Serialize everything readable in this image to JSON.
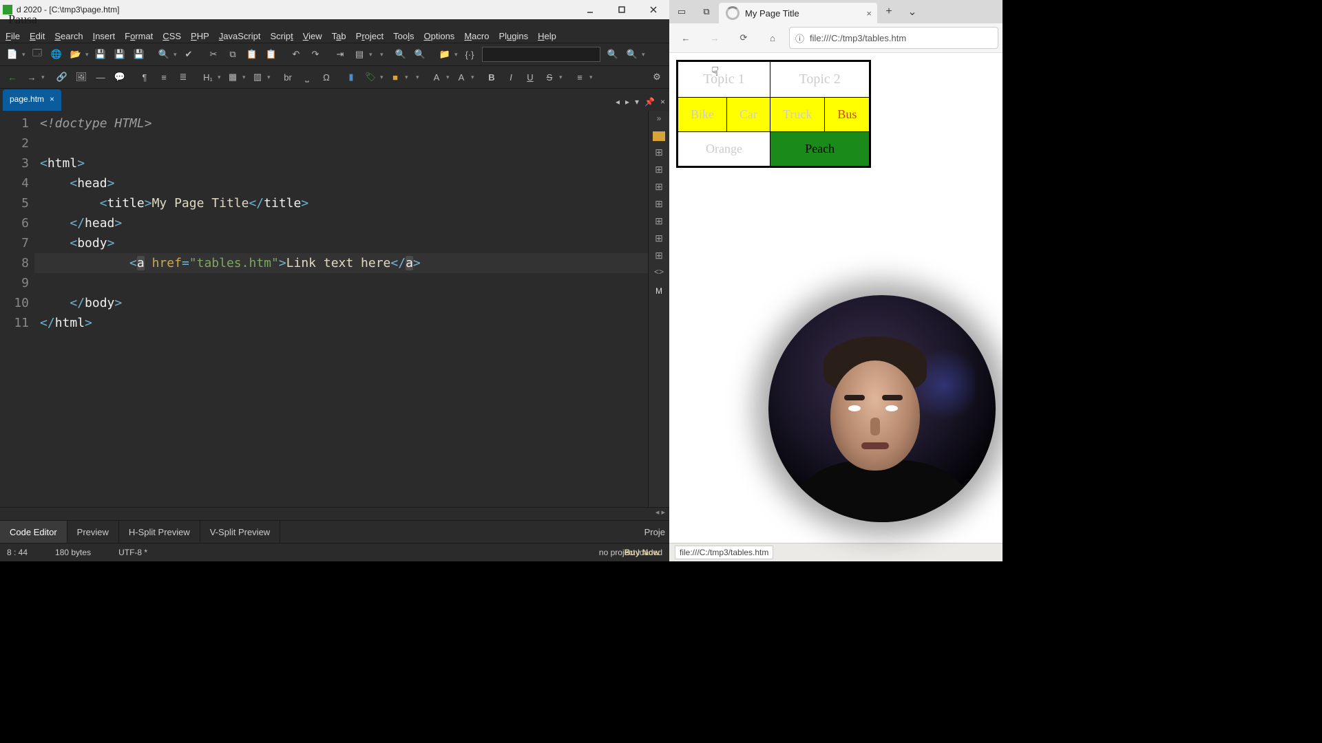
{
  "editor": {
    "titlebar": "  d 2020 - [C:\\tmp3\\page.htm]",
    "overlay": "Pausa",
    "menu": [
      "File",
      "Edit",
      "Search",
      "Insert",
      "Format",
      "CSS",
      "PHP",
      "JavaScript",
      "Script",
      "View",
      "Tab",
      "Project",
      "Tools",
      "Options",
      "Macro",
      "Plugins",
      "Help"
    ],
    "tab_label": "page.htm",
    "bottom_tabs": [
      "Code Editor",
      "Preview",
      "H-Split Preview",
      "V-Split Preview"
    ],
    "bottom_right": "Proje",
    "status": {
      "pos": "8 : 44",
      "size": "180 bytes",
      "enc": "UTF-8 *",
      "proj": "no project loaded",
      "buy": "Buy Now"
    },
    "gutter": [
      "1",
      "2",
      "3",
      "4",
      "5",
      "6",
      "7",
      "8",
      "9",
      "10",
      "11"
    ],
    "code": {
      "l1_doctype": "<!doctype HTML>",
      "l3_html_open": "html",
      "l4_head_open": "head",
      "l5_title_open": "title",
      "l5_title_text": "My Page Title",
      "l5_title_close": "title",
      "l6_head_close": "head",
      "l7_body_open": "body",
      "l8_a": "a",
      "l8_href_attr": "href",
      "l8_href_val": "\"tables.htm\"",
      "l8_link_text": "Link text here",
      "l10_body_close": "body",
      "l11_html_close": "html"
    },
    "right_panel_label": "M"
  },
  "browser": {
    "tab_title": "My Page Title",
    "url": "file:///C:/tmp3/tables.htm",
    "status": "file:///C:/tmp3/tables.htm",
    "table": {
      "head": [
        "Topic 1",
        "Topic 2"
      ],
      "row_yellow": [
        "Bike",
        "Car",
        "Truck",
        "Bus"
      ],
      "row_last": [
        "Orange",
        "Peach"
      ]
    }
  }
}
